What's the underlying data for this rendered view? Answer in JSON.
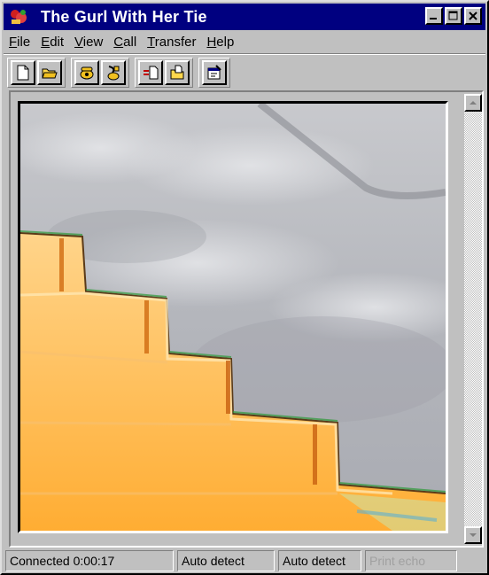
{
  "window": {
    "title": "The Gurl With Her Tie"
  },
  "title_controls": [
    "minimize",
    "maximize",
    "close"
  ],
  "menu": [
    {
      "label": "File",
      "mnemonic": "F",
      "rest": "ile"
    },
    {
      "label": "Edit",
      "mnemonic": "E",
      "rest": "dit"
    },
    {
      "label": "View",
      "mnemonic": "V",
      "rest": "iew"
    },
    {
      "label": "Call",
      "mnemonic": "C",
      "rest": "all"
    },
    {
      "label": "Transfer",
      "mnemonic": "T",
      "rest": "ransfer"
    },
    {
      "label": "Help",
      "mnemonic": "H",
      "rest": "elp"
    }
  ],
  "toolbar": {
    "icons": [
      "new-document-icon",
      "open-folder-icon",
      "connect-phone-icon",
      "disconnect-phone-icon",
      "send-file-icon",
      "receive-file-icon",
      "properties-icon"
    ]
  },
  "status": {
    "connection": "Connected 0:00:17",
    "emulation": "Auto detect",
    "settings": "Auto detect",
    "print_echo": "Print echo"
  },
  "colors": {
    "titlebar": "#000080",
    "chrome": "#c0c0c0",
    "stairs": "#ffb84d",
    "sky": "#b4b6bc"
  }
}
